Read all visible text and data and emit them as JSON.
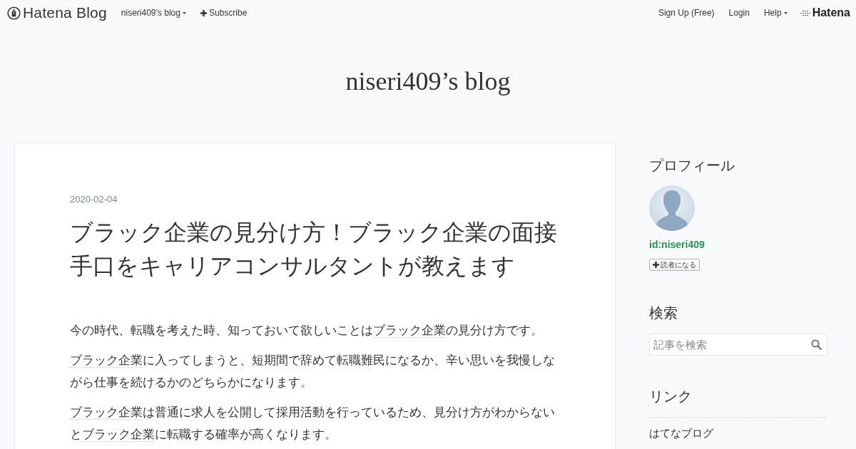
{
  "header": {
    "logo": "Hatena Blog",
    "blog_menu": "niseri409’s blog",
    "subscribe": "Subscribe",
    "links": [
      "Sign Up (Free)",
      "Login"
    ],
    "help": "Help",
    "hatena_logo": "Hatena"
  },
  "blog_title": "niseri409’s blog",
  "entry": {
    "date": "2020-02-04",
    "title": "ブラック企業の見分け方！ブラック企業の面接手口をキャリアコンサルタントが教えます",
    "paragraphs": [
      [
        {
          "kind": "text",
          "text": "今の時代、転職を考えた時、知っておいて欲しいことは"
        },
        {
          "kind": "keyword",
          "text": "ブラック企業"
        },
        {
          "kind": "text",
          "text": "の見分け方です。"
        }
      ],
      [
        {
          "kind": "keyword",
          "text": "ブラック企業"
        },
        {
          "kind": "text",
          "text": "に入ってしまうと、短期間で辞めて転職難民になるか、辛い思いを我慢しながら仕事を続けるかのどちらかになります。"
        }
      ],
      [
        {
          "kind": "keyword",
          "text": "ブラック企業"
        },
        {
          "kind": "text",
          "text": "は普通に求人を公開して採用活動を行っているため、見分け方がわからないと"
        },
        {
          "kind": "keyword",
          "text": "ブラック企業"
        },
        {
          "kind": "text",
          "text": "に転職する確率が高くなります。"
        }
      ]
    ]
  },
  "sidebar": [
    {
      "kind": "profile",
      "title": "プロフィール",
      "user_id": "id:niseri409",
      "follow_button": "読者になる"
    },
    {
      "kind": "search",
      "title": "検索",
      "placeholder": "記事を検索"
    },
    {
      "kind": "links",
      "title": "リンク",
      "items": [
        "はてなブログ"
      ]
    }
  ]
}
